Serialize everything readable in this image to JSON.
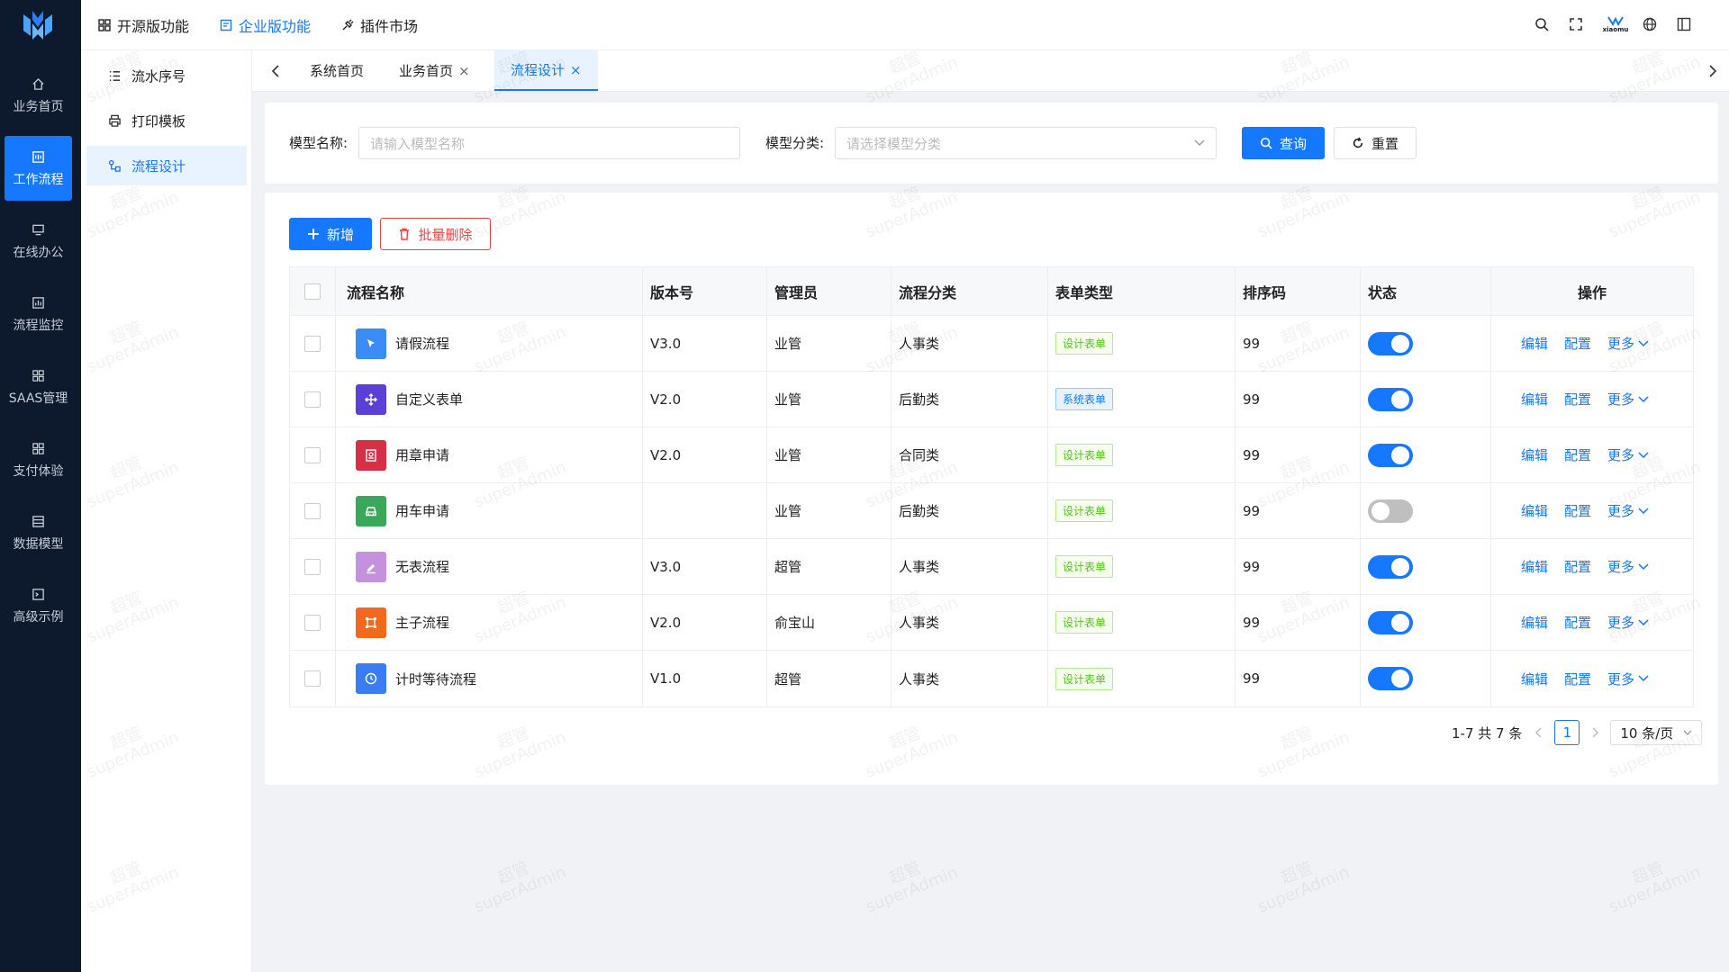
{
  "colors": {
    "rail_bg": "#0d1a2e",
    "accent": "#1677ff",
    "danger": "#f53f3f",
    "success": "#52c41a"
  },
  "rail": {
    "items": [
      {
        "label": "业务首页",
        "icon": "home-icon"
      },
      {
        "label": "工作流程",
        "icon": "workflow-icon",
        "active": true
      },
      {
        "label": "在线办公",
        "icon": "monitor-icon"
      },
      {
        "label": "流程监控",
        "icon": "monitor-chart-icon"
      },
      {
        "label": "SAAS管理",
        "icon": "grid-icon"
      },
      {
        "label": "支付体验",
        "icon": "grid-icon"
      },
      {
        "label": "数据模型",
        "icon": "table-icon"
      },
      {
        "label": "高级示例",
        "icon": "terminal-icon"
      }
    ]
  },
  "subnav": {
    "items": [
      {
        "label": "流水序号",
        "icon": "list-icon"
      },
      {
        "label": "打印模板",
        "icon": "printer-icon"
      },
      {
        "label": "流程设计",
        "icon": "flow-design-icon",
        "active": true
      }
    ]
  },
  "header": {
    "nav": [
      {
        "label": "开源版功能",
        "icon": "apps-icon"
      },
      {
        "label": "企业版功能",
        "icon": "enterprise-icon",
        "active": true
      },
      {
        "label": "插件市场",
        "icon": "plugin-icon"
      }
    ],
    "brand": "xiaomu",
    "icons": [
      "search-icon",
      "fullscreen-icon",
      "brand-logo",
      "globe-icon",
      "layout-icon"
    ]
  },
  "tabs": {
    "items": [
      {
        "label": "系统首页",
        "closable": false
      },
      {
        "label": "业务首页",
        "closable": true
      },
      {
        "label": "流程设计",
        "closable": true,
        "active": true
      }
    ],
    "close_glyph": "×"
  },
  "search": {
    "model_name_label": "模型名称:",
    "model_name_placeholder": "请输入模型名称",
    "model_category_label": "模型分类:",
    "model_category_placeholder": "请选择模型分类",
    "query_button": "查询",
    "reset_button": "重置"
  },
  "toolbar": {
    "add_button": "新增",
    "batch_delete_button": "批量删除"
  },
  "table": {
    "columns": [
      "流程名称",
      "版本号",
      "管理员",
      "流程分类",
      "表单类型",
      "排序码",
      "状态",
      "操作"
    ],
    "actions": {
      "edit": "编辑",
      "config": "配置",
      "more": "更多"
    },
    "rows": [
      {
        "name": "请假流程",
        "icon": "cursor-icon",
        "icon_color": "#3c8cf7",
        "version": "V3.0",
        "admin": "业管",
        "category": "人事类",
        "form_type": "设计表单",
        "form_kind": "design",
        "sort": "99",
        "enabled": true
      },
      {
        "name": "自定义表单",
        "icon": "move-icon",
        "icon_color": "#5b3fd6",
        "version": "V2.0",
        "admin": "业管",
        "category": "后勤类",
        "form_type": "系统表单",
        "form_kind": "system",
        "sort": "99",
        "enabled": true
      },
      {
        "name": "用章申请",
        "icon": "stamp-icon",
        "icon_color": "#d63046",
        "version": "V2.0",
        "admin": "业管",
        "category": "合同类",
        "form_type": "设计表单",
        "form_kind": "design",
        "sort": "99",
        "enabled": true
      },
      {
        "name": "用车申请",
        "icon": "car-icon",
        "icon_color": "#3aa85a",
        "version": "",
        "admin": "业管",
        "category": "后勤类",
        "form_type": "设计表单",
        "form_kind": "design",
        "sort": "99",
        "enabled": false
      },
      {
        "name": "无表流程",
        "icon": "edit-icon",
        "icon_color": "#c590de",
        "version": "V3.0",
        "admin": "超管",
        "category": "人事类",
        "form_type": "设计表单",
        "form_kind": "design",
        "sort": "99",
        "enabled": true
      },
      {
        "name": "主子流程",
        "icon": "frame-icon",
        "icon_color": "#f2691d",
        "version": "V2.0",
        "admin": "俞宝山",
        "category": "人事类",
        "form_type": "设计表单",
        "form_kind": "design",
        "sort": "99",
        "enabled": true
      },
      {
        "name": "计时等待流程",
        "icon": "clock-icon",
        "icon_color": "#3a7cf2",
        "version": "V1.0",
        "admin": "超管",
        "category": "人事类",
        "form_type": "设计表单",
        "form_kind": "design",
        "sort": "99",
        "enabled": true
      }
    ]
  },
  "pagination": {
    "summary": "1-7 共 7 条",
    "current_page": "1",
    "page_size": "10 条/页"
  },
  "watermark": {
    "line1": "超管",
    "line2": "superAdmin"
  }
}
